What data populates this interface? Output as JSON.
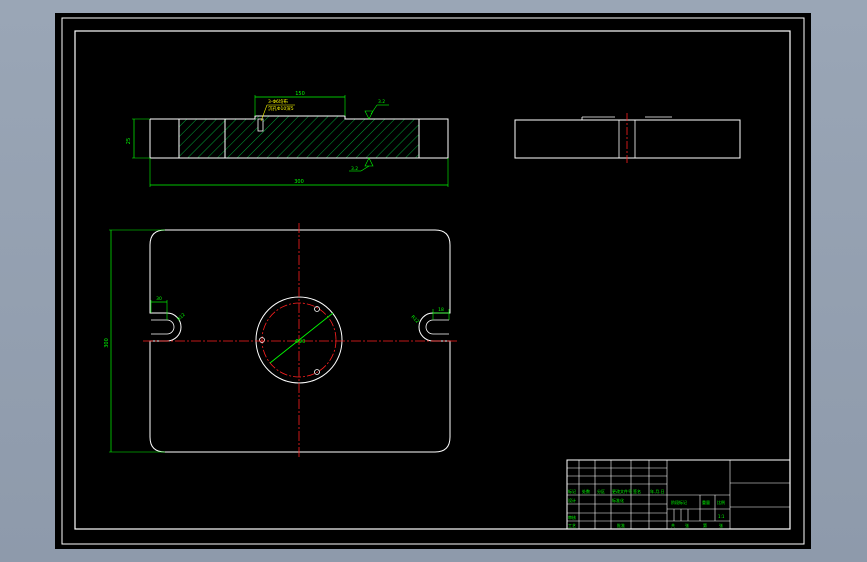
{
  "dimensions": {
    "top_width": "150",
    "thickness": "25",
    "total_length": "300",
    "plan_height": "300",
    "slot_left": "30",
    "slot_right": "18",
    "slot_r_left": "R12",
    "slot_r_right": "R12",
    "circle_dia": "Φ90"
  },
  "annotations": {
    "hole_note_1": "3-Φ6均布",
    "hole_note_2": "沉孔Φ10深5",
    "roughness_top": "3.2",
    "roughness_bottom": "3.2"
  },
  "title_block": {
    "labels": [
      "标记",
      "处数",
      "分区",
      "更改文件号",
      "签名",
      "年.月.日"
    ],
    "design": "设计",
    "standard": "标准化",
    "review": "审核",
    "process": "工艺",
    "approve": "批准",
    "stage": "阶段标记",
    "weight": "重量",
    "scale": "比例",
    "scale_value": "1:1",
    "sheets": [
      "共",
      "张",
      "第",
      "张"
    ]
  },
  "colors": {
    "outline": "#ffffff",
    "centerline": "#ff2020",
    "dimension": "#00ff00",
    "hatch": "#00cc44",
    "note": "#ffff00"
  }
}
